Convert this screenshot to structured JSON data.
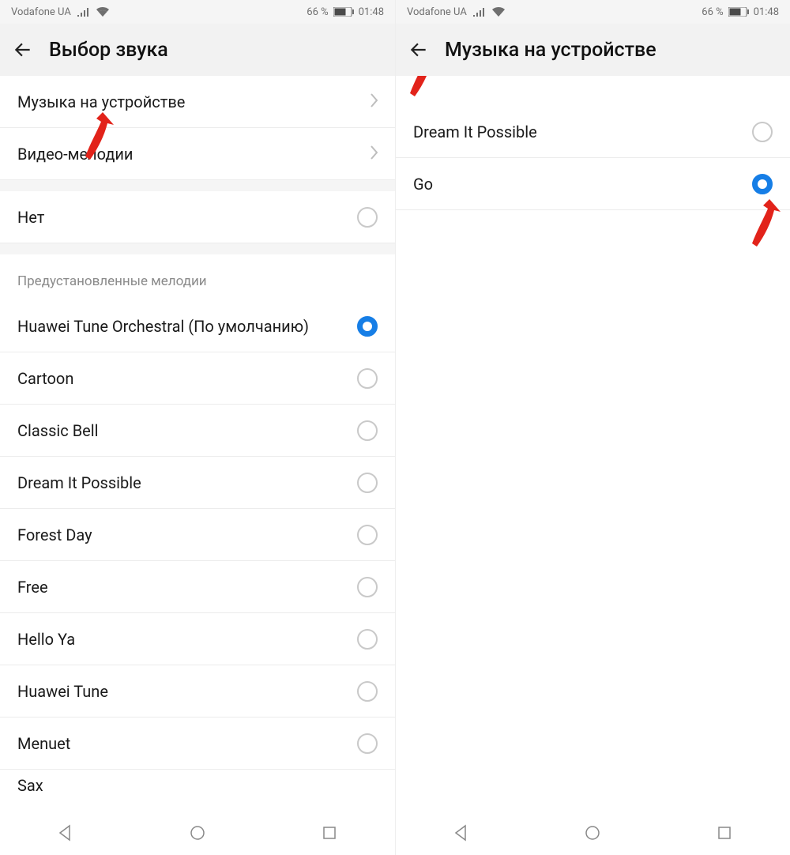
{
  "statusbar": {
    "carrier": "Vodafone UA",
    "battery_pct": "66 %",
    "time": "01:48"
  },
  "left_screen": {
    "title": "Выбор звука",
    "nav_rows": [
      {
        "label": "Музыка на устройстве"
      },
      {
        "label": "Видео-мелодии"
      }
    ],
    "none_row": {
      "label": "Нет"
    },
    "section_header": "Предустановленные мелодии",
    "ringtones": [
      {
        "label": "Huawei Tune Orchestral (По умолчанию)",
        "selected": true
      },
      {
        "label": "Cartoon",
        "selected": false
      },
      {
        "label": "Classic Bell",
        "selected": false
      },
      {
        "label": "Dream It Possible",
        "selected": false
      },
      {
        "label": "Forest Day",
        "selected": false
      },
      {
        "label": "Free",
        "selected": false
      },
      {
        "label": "Hello Ya",
        "selected": false
      },
      {
        "label": "Huawei Tune",
        "selected": false
      },
      {
        "label": "Menuet",
        "selected": false
      },
      {
        "label": "Sax",
        "selected": false
      }
    ]
  },
  "right_screen": {
    "title": "Музыка на устройстве",
    "tracks": [
      {
        "label": "Dream It Possible",
        "selected": false
      },
      {
        "label": "Go",
        "selected": true
      }
    ]
  }
}
